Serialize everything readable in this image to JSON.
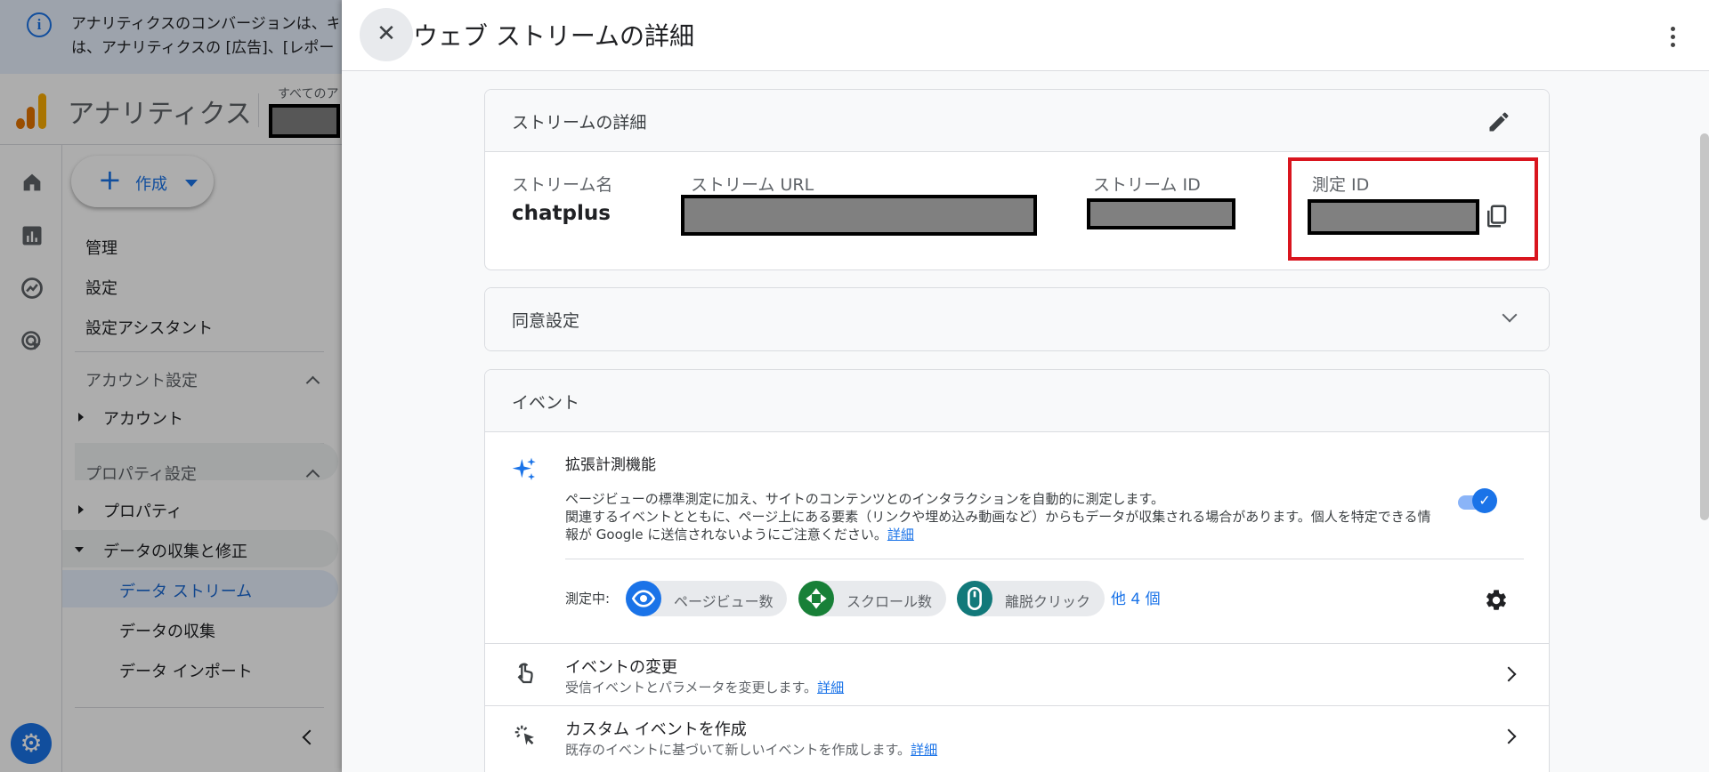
{
  "banner": {
    "line1": "アナリティクスのコンバージョンは、キー",
    "line2": "は、アナリティクスの [広告]、[レポート"
  },
  "app": {
    "title": "アナリティクス",
    "property_label": "すべてのア"
  },
  "sidebar": {
    "create_label": "作成",
    "items": {
      "admin": "管理",
      "settings": "設定",
      "setup_assistant": "設定アシスタント",
      "account_settings": "アカウント設定",
      "account": "アカウント",
      "property_settings": "プロパティ設定",
      "property": "プロパティ",
      "data_collection_modification": "データの収集と修正",
      "data_streams": "データ ストリーム",
      "data_collection": "データの収集",
      "data_import": "データ インポート"
    }
  },
  "panel": {
    "title": "ウェブ ストリームの詳細",
    "stream_details": {
      "title": "ストリームの詳細",
      "fields": {
        "stream_name_label": "ストリーム名",
        "stream_name_value": "chatplus",
        "stream_url_label": "ストリーム URL",
        "stream_id_label": "ストリーム ID",
        "measurement_id_label": "測定 ID"
      }
    },
    "consent": {
      "title": "同意設定"
    },
    "events": {
      "title": "イベント",
      "enhanced": {
        "title": "拡張計測機能",
        "desc_line1": "ページビューの標準測定に加え、サイトのコンテンツとのインタラクションを自動的に測定します。",
        "desc_line2": "関連するイベントとともに、ページ上にある要素（リンクや埋め込み動画など）からもデータが収集される場合があります。個人を特定できる情",
        "desc_line3": "報が Google に送信されないようにご注意ください。",
        "details_link": "詳細",
        "enabled": true
      },
      "measuring_label": "測定中:",
      "chips": [
        {
          "label": "ページビュー数",
          "icon": "eye-icon",
          "color": "#1a73e8"
        },
        {
          "label": "スクロール数",
          "icon": "scroll-icon",
          "color": "#188038"
        },
        {
          "label": "離脱クリック",
          "icon": "mouse-icon",
          "color": "#12797a"
        }
      ],
      "more_label": "他 4 個",
      "rows": [
        {
          "title": "イベントの変更",
          "subtitle": "受信イベントとパラメータを変更します。",
          "link": "詳細"
        },
        {
          "title": "カスタム イベントを作成",
          "subtitle": "既存のイベントに基づいて新しいイベントを作成します。",
          "link": "詳細"
        }
      ]
    }
  },
  "colors": {
    "accent": "#1a73e8",
    "highlight": "#d9151e",
    "redaction": "#808080"
  }
}
